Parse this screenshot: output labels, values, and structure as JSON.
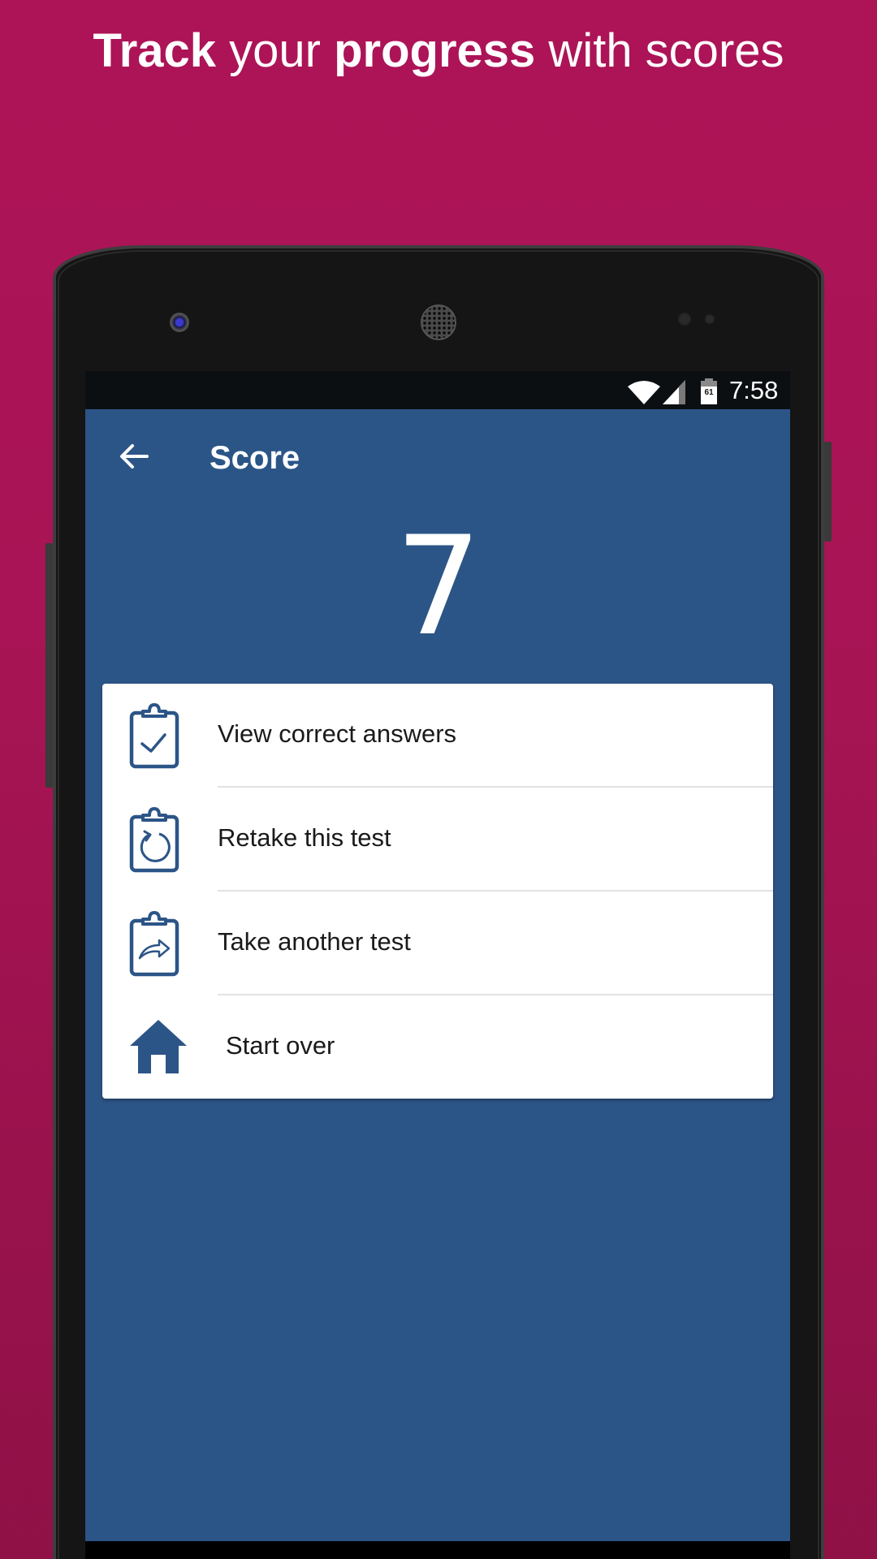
{
  "promo": {
    "headline_parts": [
      {
        "text": "Track",
        "bold": true
      },
      {
        "text": " your ",
        "bold": false
      },
      {
        "text": "progress",
        "bold": true
      },
      {
        "text": " with scores",
        "bold": false
      }
    ]
  },
  "status_bar": {
    "time": "7:58",
    "battery_level": "61",
    "icons": [
      "wifi-icon",
      "cell-signal-icon",
      "battery-icon"
    ]
  },
  "app_bar": {
    "back_icon": "arrow-back-icon",
    "title": "Score"
  },
  "score": {
    "value": "7"
  },
  "menu": {
    "items": [
      {
        "label": "View correct answers",
        "icon": "clipboard-check-icon"
      },
      {
        "label": "Retake this test",
        "icon": "clipboard-refresh-icon"
      },
      {
        "label": "Take another test",
        "icon": "clipboard-forward-icon"
      },
      {
        "label": "Start over",
        "icon": "home-icon"
      }
    ]
  },
  "colors": {
    "background": "#ad1457",
    "primary": "#2c5587",
    "status_bar": "#0c0f12",
    "card": "#ffffff",
    "text": "#1a1a1a",
    "divider": "#e2e2e2"
  }
}
